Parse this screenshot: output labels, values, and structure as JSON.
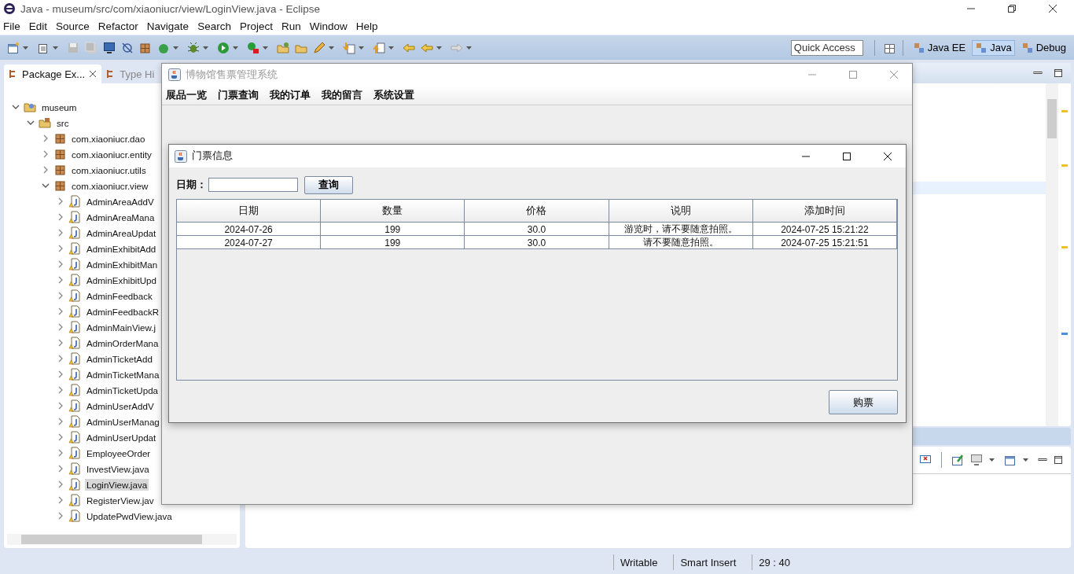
{
  "window": {
    "title": "Java - museum/src/com/xiaoniucr/view/LoginView.java - Eclipse"
  },
  "menu": [
    "File",
    "Edit",
    "Source",
    "Refactor",
    "Navigate",
    "Search",
    "Project",
    "Run",
    "Window",
    "Help"
  ],
  "quick_access": {
    "placeholder": "Quick Access"
  },
  "perspectives": [
    {
      "label": "Java EE",
      "selected": false
    },
    {
      "label": "Java",
      "selected": true
    },
    {
      "label": "Debug",
      "selected": false
    }
  ],
  "explorer_tabs": [
    {
      "label": "Package Ex...",
      "selected": true
    },
    {
      "label": "Type Hi",
      "selected": false
    }
  ],
  "tree": [
    {
      "label": "museum",
      "kind": "project",
      "expanded": true,
      "selected": false,
      "children": [
        {
          "label": "src",
          "kind": "folder",
          "expanded": true,
          "selected": false,
          "children": [
            {
              "label": "com.xiaoniucr.dao",
              "kind": "package",
              "expanded": false,
              "selected": false
            },
            {
              "label": "com.xiaoniucr.entity",
              "kind": "package",
              "expanded": false,
              "selected": false
            },
            {
              "label": "com.xiaoniucr.utils",
              "kind": "package",
              "expanded": false,
              "selected": false
            },
            {
              "label": "com.xiaoniucr.view",
              "kind": "package",
              "expanded": true,
              "selected": false,
              "children": [
                {
                  "label": "AdminAreaAddV",
                  "kind": "file",
                  "expanded": false,
                  "selected": false
                },
                {
                  "label": "AdminAreaMana",
                  "kind": "file",
                  "expanded": false,
                  "selected": false
                },
                {
                  "label": "AdminAreaUpdat",
                  "kind": "file",
                  "expanded": false,
                  "selected": false
                },
                {
                  "label": "AdminExhibitAdd",
                  "kind": "file",
                  "expanded": false,
                  "selected": false
                },
                {
                  "label": "AdminExhibitMan",
                  "kind": "file",
                  "expanded": false,
                  "selected": false
                },
                {
                  "label": "AdminExhibitUpd",
                  "kind": "file",
                  "expanded": false,
                  "selected": false
                },
                {
                  "label": "AdminFeedback",
                  "kind": "file",
                  "expanded": false,
                  "selected": false
                },
                {
                  "label": "AdminFeedbackR",
                  "kind": "file",
                  "expanded": false,
                  "selected": false
                },
                {
                  "label": "AdminMainView.j",
                  "kind": "file",
                  "expanded": false,
                  "selected": false
                },
                {
                  "label": "AdminOrderMana",
                  "kind": "file",
                  "expanded": false,
                  "selected": false
                },
                {
                  "label": "AdminTicketAdd",
                  "kind": "file",
                  "expanded": false,
                  "selected": false
                },
                {
                  "label": "AdminTicketMana",
                  "kind": "file",
                  "expanded": false,
                  "selected": false
                },
                {
                  "label": "AdminTicketUpda",
                  "kind": "file",
                  "expanded": false,
                  "selected": false
                },
                {
                  "label": "AdminUserAddV",
                  "kind": "file",
                  "expanded": false,
                  "selected": false
                },
                {
                  "label": "AdminUserManag",
                  "kind": "file",
                  "expanded": false,
                  "selected": false
                },
                {
                  "label": "AdminUserUpdat",
                  "kind": "file",
                  "expanded": false,
                  "selected": false
                },
                {
                  "label": "EmployeeOrder",
                  "kind": "file",
                  "expanded": false,
                  "selected": false
                },
                {
                  "label": "InvestView.java",
                  "kind": "file",
                  "expanded": false,
                  "selected": false
                },
                {
                  "label": "LoginView.java",
                  "kind": "file",
                  "expanded": false,
                  "selected": true
                },
                {
                  "label": "RegisterView.jav",
                  "kind": "file",
                  "expanded": false,
                  "selected": false
                },
                {
                  "label": "UpdatePwdView.java",
                  "kind": "file",
                  "expanded": false,
                  "selected": false
                }
              ]
            }
          ]
        }
      ]
    }
  ],
  "app_window": {
    "title": "博物馆售票管理系统",
    "menu": [
      "展品一览",
      "门票查询",
      "我的订单",
      "我的留言",
      "系统设置"
    ]
  },
  "dialog": {
    "title": "门票信息",
    "date_label": "日期：",
    "query_button": "查询",
    "table": {
      "columns": [
        "日期",
        "数量",
        "价格",
        "说明",
        "添加时间"
      ],
      "rows": [
        [
          "2024-07-26",
          "199",
          "30.0",
          "游览时，请不要随意拍照。",
          "2024-07-25 15:21:22"
        ],
        [
          "2024-07-27",
          "199",
          "30.0",
          "请不要随意拍照。",
          "2024-07-25 15:21:51"
        ]
      ]
    },
    "buy_button": "购票"
  },
  "status_bar": [
    "Writable",
    "Smart Insert",
    "29 : 40"
  ]
}
